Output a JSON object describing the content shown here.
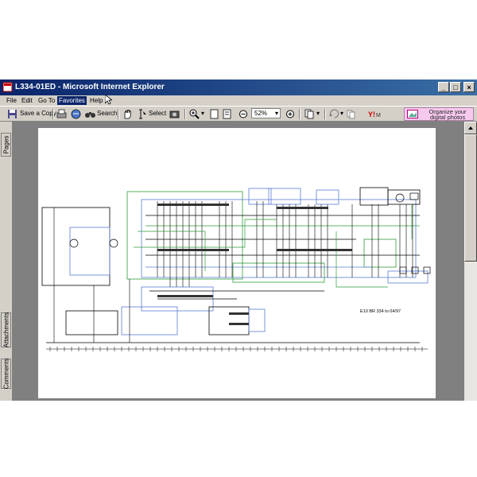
{
  "window": {
    "title": "L334-01ED - Microsoft Internet Explorer",
    "controls": [
      "minimize",
      "maximize",
      "close"
    ]
  },
  "menu": [
    "File",
    "Edit",
    "Go To",
    "Favorites",
    "Help"
  ],
  "menu_highlighted": "Favorites",
  "toolbar": {
    "save_copy_label": "Save a Copy",
    "search_label": "Search",
    "select_label": "Select",
    "zoom_value": "52%"
  },
  "ad": {
    "text": "Organize your digital photos"
  },
  "side_tabs": [
    "Pages",
    "Attachments",
    "Comments"
  ],
  "document": {
    "caption": "E10 BR 334 to 04/97"
  },
  "colors": {
    "title_gradient_start": "#0a246a",
    "title_gradient_end": "#3a6ea5",
    "chrome": "#d4d0c8",
    "viewport_bg": "#808080",
    "wire_green": "#2e9b3a",
    "wire_blue": "#5a7bd6",
    "highlight": "#0a246a"
  }
}
